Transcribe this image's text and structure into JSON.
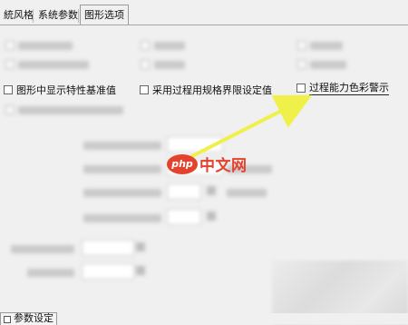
{
  "tabs": [
    {
      "label": "統风格"
    },
    {
      "label": "系统参数"
    },
    {
      "label": "图形选项",
      "active": true
    }
  ],
  "options": {
    "show_baseline": "图形中显示特性基准值",
    "use_spec_limits": "采用过程用规格界限设定值",
    "process_capability_warning": "过程能力色彩警示"
  },
  "watermark": {
    "logo": "php",
    "site": "中文网"
  },
  "bottom": {
    "button_label": "参数设定"
  },
  "colors": {
    "arrow": "#f0f04a",
    "logo": "#e3422e"
  }
}
